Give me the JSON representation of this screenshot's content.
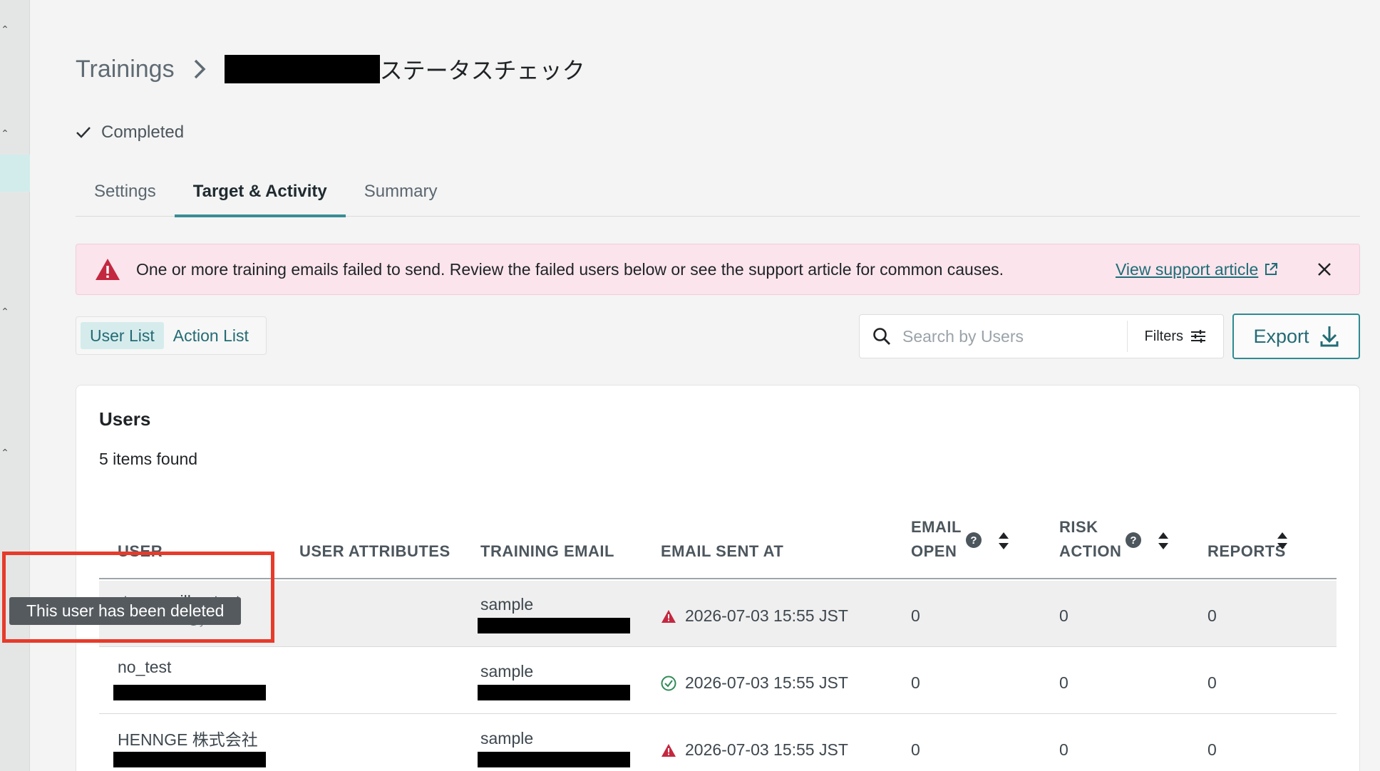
{
  "breadcrumb": {
    "root": "Trainings",
    "title": "ステータスチェック"
  },
  "status": {
    "label": "Completed"
  },
  "tabs": [
    "Settings",
    "Target & Activity",
    "Summary"
  ],
  "alert": {
    "message": "One or more training emails failed to send. Review the failed users below or see the support article for common causes.",
    "link": "View support article"
  },
  "list_toggle": {
    "user_list": "User List",
    "action_list": "Action List"
  },
  "search": {
    "placeholder": "Search by Users"
  },
  "filters_label": "Filters",
  "export_label": "Export",
  "users": {
    "title": "Users",
    "count": "5 items found",
    "columns": {
      "user": "USER",
      "attributes": "USER ATTRIBUTES",
      "training_email": "TRAINING EMAIL",
      "email_sent_at": "EMAIL SENT AT",
      "email_open_1": "EMAIL",
      "email_open_2": "OPEN",
      "risk_action_1": "RISK",
      "risk_action_2": "ACTION",
      "reports": "REPORTS"
    },
    "rows": [
      {
        "user": "nomailboxtest",
        "sub": "nomailboxtest@yello...",
        "training_email": "sample",
        "sent_at": "2026-07-03 15:55 JST",
        "sent_status": "failed",
        "email_open": "0",
        "risk_action": "0",
        "reports": "0"
      },
      {
        "user": "no_test",
        "training_email": "sample",
        "sent_at": "2026-07-03 15:55 JST",
        "sent_status": "success",
        "email_open": "0",
        "risk_action": "0",
        "reports": "0"
      },
      {
        "user": "HENNGE 株式会社",
        "training_email": "sample",
        "sent_at": "2026-07-03 15:55 JST",
        "sent_status": "failed",
        "email_open": "0",
        "risk_action": "0",
        "reports": "0"
      }
    ]
  },
  "tooltip": "This user has been deleted",
  "colors": {
    "accent": "#2f8a93",
    "danger": "#c3283f",
    "success": "#2e8b57",
    "alert_bg": "#fbe4ec",
    "highlight": "#e63b2b"
  }
}
